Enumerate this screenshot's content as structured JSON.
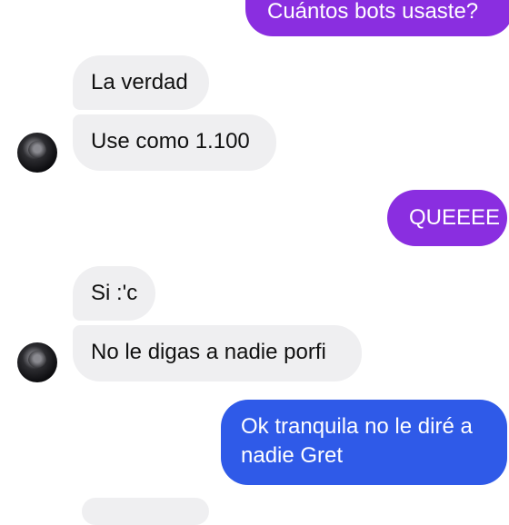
{
  "conversation": {
    "messages": [
      {
        "from": "me",
        "text": "Cuántos bots usaste?"
      },
      {
        "from": "them",
        "text": "La verdad"
      },
      {
        "from": "them",
        "text": "Use como 1.100"
      },
      {
        "from": "me",
        "text": "QUEEEE"
      },
      {
        "from": "them",
        "text": "Si :'c"
      },
      {
        "from": "them",
        "text": "No le digas a nadie porfi"
      },
      {
        "from": "me",
        "text": "Ok tranquila no le diré a nadie Gret"
      }
    ]
  },
  "colors": {
    "outgoing_purple": "#8a2ee0",
    "outgoing_blue": "#2f5ae8",
    "incoming_gray": "#efeff1"
  },
  "icons": {
    "contact_avatar": "avatar-icon"
  }
}
